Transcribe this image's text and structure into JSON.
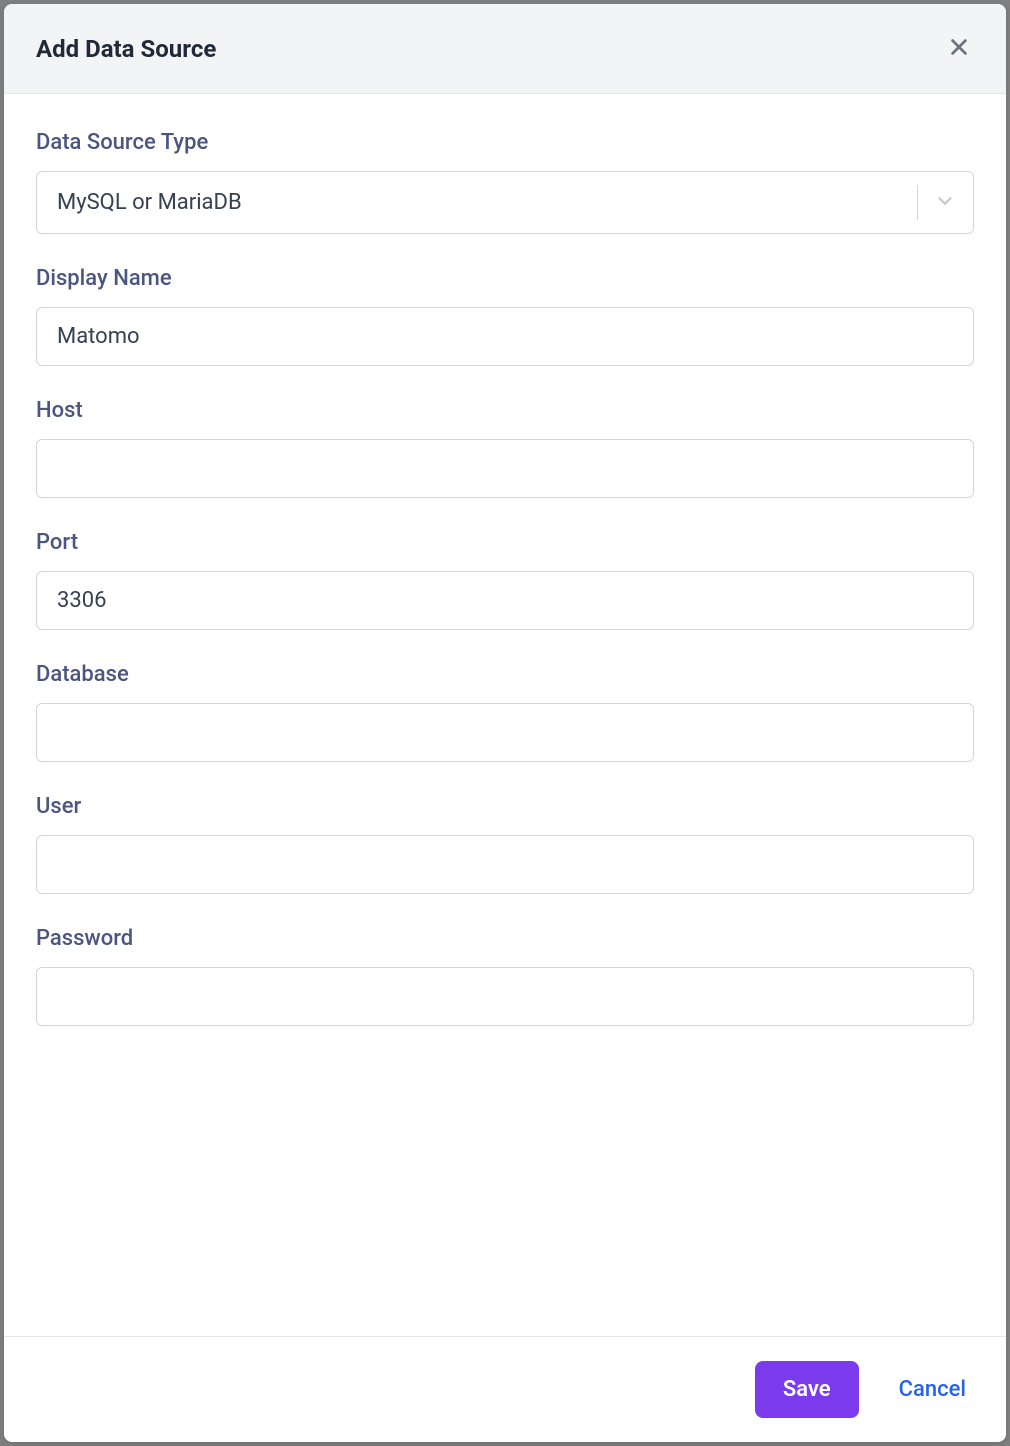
{
  "modal": {
    "title": "Add Data Source"
  },
  "form": {
    "type_label": "Data Source Type",
    "type_value": "MySQL or MariaDB",
    "display_name_label": "Display Name",
    "display_name_value": "Matomo",
    "host_label": "Host",
    "host_value": "",
    "port_label": "Port",
    "port_value": "3306",
    "database_label": "Database",
    "database_value": "",
    "user_label": "User",
    "user_value": "",
    "password_label": "Password",
    "password_value": ""
  },
  "footer": {
    "save_label": "Save",
    "cancel_label": "Cancel"
  }
}
